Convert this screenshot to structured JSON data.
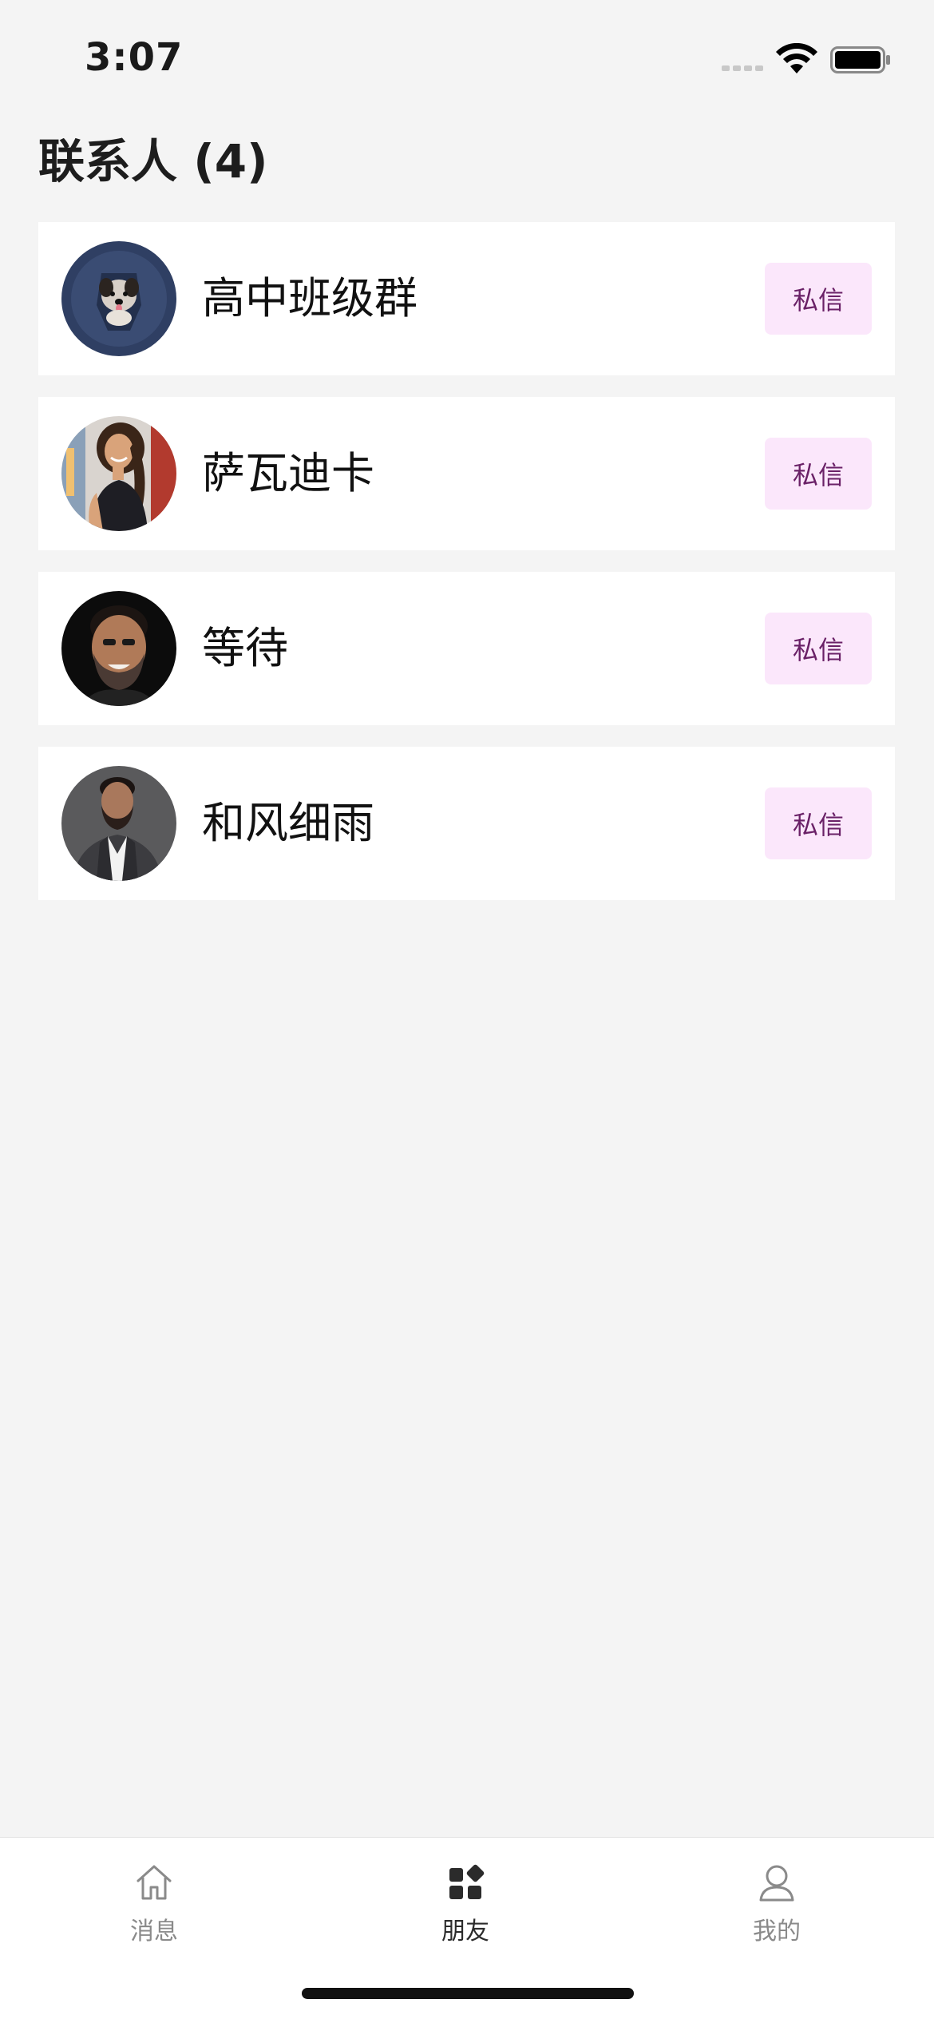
{
  "status_bar": {
    "time": "3:07"
  },
  "page": {
    "title": "联系人 (4)"
  },
  "contacts": [
    {
      "name": "高中班级群",
      "action_label": "私信",
      "avatar": "puppy-photo"
    },
    {
      "name": "萨瓦迪卡",
      "action_label": "私信",
      "avatar": "woman-photo"
    },
    {
      "name": "等待",
      "action_label": "私信",
      "avatar": "smiling-man-photo"
    },
    {
      "name": "和风细雨",
      "action_label": "私信",
      "avatar": "man-in-suit-photo"
    }
  ],
  "tab_bar": {
    "items": [
      {
        "label": "消息",
        "icon": "home-icon",
        "active": false
      },
      {
        "label": "朋友",
        "icon": "grid-icon",
        "active": true
      },
      {
        "label": "我的",
        "icon": "user-icon",
        "active": false
      }
    ]
  },
  "colors": {
    "background": "#f4f4f4",
    "card": "#ffffff",
    "button_bg": "#fbe7fb",
    "button_text": "#6a2167",
    "active_tab": "#2b2b2b",
    "inactive_tab": "#8a8a8a"
  }
}
